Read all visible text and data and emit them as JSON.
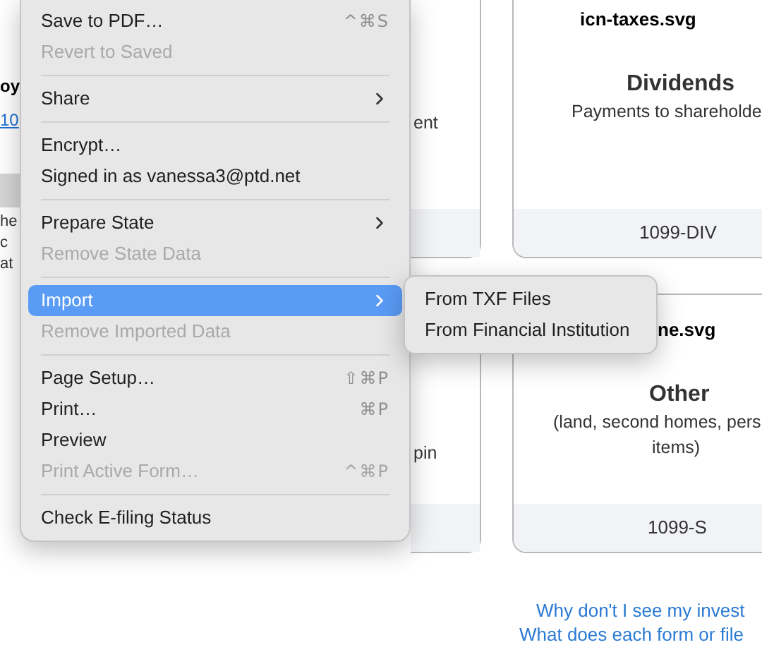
{
  "page": {
    "left_fragments": [
      {
        "text": "oy",
        "kind": "bold"
      },
      {
        "text": "10",
        "kind": "link"
      },
      {
        "text": "he",
        "kind": "plain"
      },
      {
        "text": "c",
        "kind": "plain"
      },
      {
        "text": "at",
        "kind": "plain"
      }
    ],
    "card_rows": [
      {
        "partial_text": "ent",
        "card": {
          "icon_file": "icn-taxes.svg",
          "title": "Dividends",
          "description": [
            "Payments to shareholde"
          ],
          "form": "1099-DIV"
        }
      },
      {
        "partial_text": "pin",
        "card": {
          "icon_file": "ne.svg",
          "title": "Other",
          "description": [
            "(land, second homes, pers",
            "items)"
          ],
          "form": "1099-S"
        }
      }
    ],
    "links": [
      "Why don't I see my invest",
      "What does each form or file"
    ]
  },
  "menu": {
    "items": [
      {
        "kind": "item",
        "label": "Save to PDF…",
        "shortcut": "^⌘S",
        "disabled": false,
        "selected": false,
        "submenu": false
      },
      {
        "kind": "item",
        "label": "Revert to Saved",
        "disabled": true,
        "selected": false,
        "submenu": false
      },
      {
        "kind": "separator"
      },
      {
        "kind": "item",
        "label": "Share",
        "disabled": false,
        "selected": false,
        "submenu": true
      },
      {
        "kind": "separator"
      },
      {
        "kind": "item",
        "label": "Encrypt…",
        "disabled": false,
        "selected": false,
        "submenu": false
      },
      {
        "kind": "item",
        "label": "Signed in as vanessa3@ptd.net",
        "disabled": false,
        "selected": false,
        "submenu": false
      },
      {
        "kind": "separator"
      },
      {
        "kind": "item",
        "label": "Prepare State",
        "disabled": false,
        "selected": false,
        "submenu": true
      },
      {
        "kind": "item",
        "label": "Remove State Data",
        "disabled": true,
        "selected": false,
        "submenu": false
      },
      {
        "kind": "separator"
      },
      {
        "kind": "item",
        "label": "Import",
        "disabled": false,
        "selected": true,
        "submenu": true
      },
      {
        "kind": "item",
        "label": "Remove Imported Data",
        "disabled": true,
        "selected": false,
        "submenu": false
      },
      {
        "kind": "separator"
      },
      {
        "kind": "item",
        "label": "Page Setup…",
        "shortcut": "⇧⌘P",
        "disabled": false,
        "selected": false,
        "submenu": false
      },
      {
        "kind": "item",
        "label": "Print…",
        "shortcut": "⌘P",
        "disabled": false,
        "selected": false,
        "submenu": false
      },
      {
        "kind": "item",
        "label": "Preview",
        "disabled": false,
        "selected": false,
        "submenu": false
      },
      {
        "kind": "item",
        "label": "Print Active Form…",
        "shortcut": "^⌘P",
        "disabled": true,
        "selected": false,
        "submenu": false
      },
      {
        "kind": "separator"
      },
      {
        "kind": "item",
        "label": "Check E-filing Status",
        "disabled": false,
        "selected": false,
        "submenu": false
      }
    ],
    "submenu": [
      {
        "label": "From TXF Files",
        "selected": false
      },
      {
        "label": "From Financial Institution",
        "selected": false
      }
    ]
  }
}
